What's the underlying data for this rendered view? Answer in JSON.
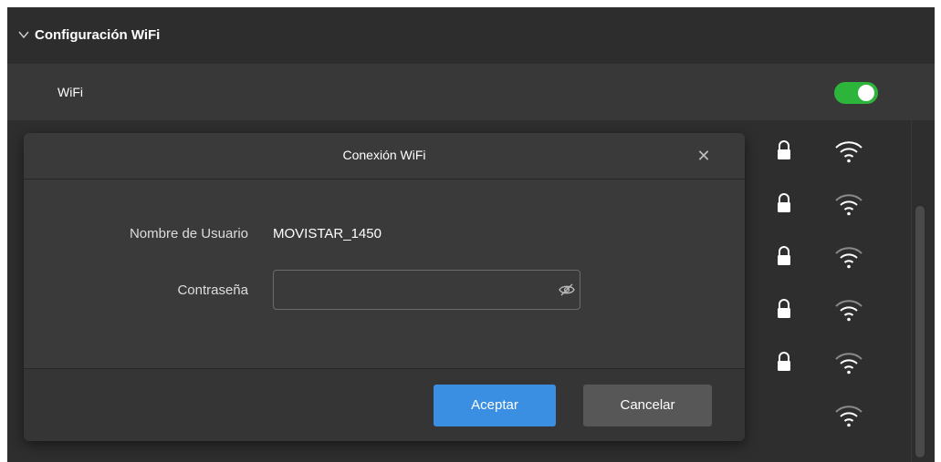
{
  "section": {
    "title": "Configuración WiFi",
    "icon": "chevron-down-icon"
  },
  "wifi_row": {
    "label": "WiFi",
    "toggle_on": true
  },
  "networks": [
    {
      "secured": true,
      "signal": 3
    },
    {
      "secured": true,
      "signal": 2
    },
    {
      "secured": true,
      "signal": 2
    },
    {
      "secured": true,
      "signal": 2
    },
    {
      "secured": true,
      "signal": 2
    },
    {
      "secured": false,
      "signal": 2
    }
  ],
  "dialog": {
    "title": "Conexión WiFi",
    "close_icon": "close-icon",
    "username_label": "Nombre de Usuario",
    "username_value": "MOVISTAR_1450",
    "password_label": "Contraseña",
    "password_value": "",
    "eye_icon": "eye-off-icon",
    "ok_label": "Aceptar",
    "cancel_label": "Cancelar"
  },
  "colors": {
    "accent": "#3b8fe3",
    "toggle_on": "#2db53b",
    "background": "#2d2d2d",
    "dialog": "#3a3a3a"
  }
}
